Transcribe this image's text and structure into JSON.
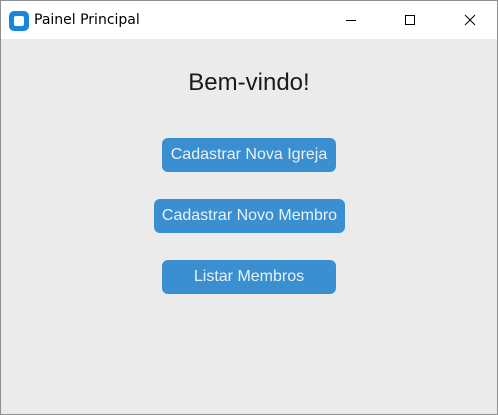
{
  "window": {
    "title": "Painel Principal",
    "icon": "app-icon",
    "controls": {
      "minimize_icon": "minimize-icon",
      "maximize_icon": "maximize-icon",
      "close_icon": "close-icon"
    }
  },
  "main": {
    "heading": "Bem-vindo!",
    "buttons": [
      {
        "label": "Cadastrar Nova Igreja"
      },
      {
        "label": "Cadastrar Novo Membro"
      },
      {
        "label": "Listar Membros"
      }
    ]
  },
  "colors": {
    "background": "#ebebeb",
    "button": "#3a8fd1",
    "button_text": "#e9f2fb",
    "app_icon": "#1a86d9"
  }
}
